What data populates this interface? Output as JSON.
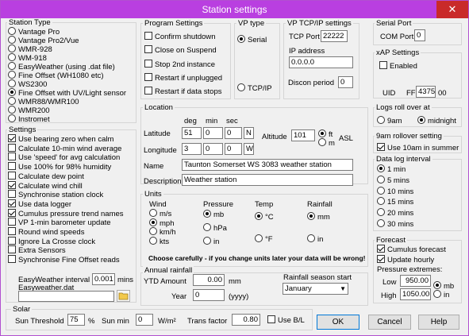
{
  "window": {
    "title": "Station settings",
    "close_glyph": "✕"
  },
  "station_type": {
    "title": "Station Type",
    "options": [
      "Vantage Pro",
      "Vantage Pro2/Vue",
      "WMR-928",
      "WM-918",
      "EasyWeather (using .dat file)",
      "Fine Offset (WH1080 etc)",
      "WS2300",
      "Fine Offset with UV/Light sensor",
      "WMR88/WMR100",
      "WMR200",
      "Instromet"
    ],
    "selected": 7
  },
  "settings": {
    "title": "Settings",
    "items": [
      {
        "label": "Use bearing zero when calm",
        "checked": true
      },
      {
        "label": "Calculate 10-min wind average",
        "checked": false
      },
      {
        "label": "Use 'speed' for avg calculation",
        "checked": false
      },
      {
        "label": "Use 100% for 98% humidity",
        "checked": false
      },
      {
        "label": "Calculate dew point",
        "checked": false
      },
      {
        "label": "Calculate wind chill",
        "checked": true
      },
      {
        "label": "Synchronise station clock",
        "checked": false
      },
      {
        "label": "Use data logger",
        "checked": true
      },
      {
        "label": "Cumulus pressure trend names",
        "checked": true
      },
      {
        "label": "VP 1-min barometer update",
        "checked": false
      },
      {
        "label": "Round wind speeds",
        "checked": false
      },
      {
        "label": "Ignore La Crosse clock",
        "checked": false
      },
      {
        "label": "Extra Sensors",
        "checked": false
      },
      {
        "label": "Synchronise Fine Offset reads",
        "checked": false
      }
    ],
    "easyweather_label": "EasyWeather interval",
    "easyweather_value": "0.001",
    "easyweather_unit": "mins",
    "easyweather_file_label": "Easyweather.dat",
    "easyweather_file_value": ""
  },
  "program": {
    "title": "Program Settings",
    "items": [
      {
        "label": "Confirm shutdown",
        "checked": false
      },
      {
        "label": "Close on Suspend",
        "checked": false
      },
      {
        "label": "Stop 2nd instance",
        "checked": false
      },
      {
        "label": "Restart if unplugged",
        "checked": false
      },
      {
        "label": "Restart if data stops",
        "checked": false
      }
    ]
  },
  "vp_type": {
    "title": "VP type",
    "serial": "Serial",
    "tcpip": "TCP/IP",
    "selected": "serial"
  },
  "vp_tcpip": {
    "title": "VP TCP/IP settings",
    "port_label": "TCP Port",
    "port_value": "22222",
    "ip_label": "IP address",
    "ip_value": "0.0.0.0",
    "discon_label": "Discon period",
    "discon_value": "0"
  },
  "serial_port": {
    "title": "Serial Port",
    "label": "COM Port",
    "value": "0"
  },
  "xap": {
    "title": "xAP Settings",
    "enabled_label": "Enabled",
    "enabled": false,
    "uid_label": "UID",
    "uid_prefix": "FF",
    "uid_value": "4375",
    "uid_suffix": "00"
  },
  "location": {
    "title": "Location",
    "hdr_deg": "deg",
    "hdr_min": "min",
    "hdr_sec": "sec",
    "lat_label": "Latitude",
    "lat_deg": "51",
    "lat_min": "0",
    "lat_sec": "0",
    "lat_hem": "N",
    "lon_label": "Longitude",
    "lon_deg": "3",
    "lon_min": "0",
    "lon_sec": "0",
    "lon_hem": "W",
    "alt_label": "Altitude",
    "alt_value": "101",
    "alt_ft": "ft",
    "alt_m": "m",
    "alt_unit_selected": "ft",
    "asl": "ASL",
    "name_label": "Name",
    "name_value": "Taunton Somerset WS 3083 weather station",
    "desc_label": "Description",
    "desc_value": "Weather station"
  },
  "units": {
    "title": "Units",
    "wind": {
      "title": "Wind",
      "options": [
        "m/s",
        "mph",
        "km/h",
        "kts"
      ],
      "selected": 1
    },
    "pressure": {
      "title": "Pressure",
      "options": [
        "mb",
        "hPa",
        "in"
      ],
      "selected": 0
    },
    "temp": {
      "title": "Temp",
      "options": [
        "°C",
        "°F"
      ],
      "selected": 0
    },
    "rainfall": {
      "title": "Rainfall",
      "options": [
        "mm",
        "in"
      ],
      "selected": 0
    },
    "warning": "Choose carefully - if you change units later your data will be wrong!"
  },
  "annual_rainfall": {
    "title": "Annual rainfall",
    "ytd_label": "YTD Amount",
    "ytd_value": "0.00",
    "ytd_unit": "mm",
    "year_label": "Year",
    "year_value": "0",
    "year_hint": "(yyyy)",
    "season_label": "Rainfall season start",
    "season_value": "January"
  },
  "logs_roll": {
    "title": "Logs roll over at",
    "options": [
      "9am",
      "midnight"
    ],
    "selected": 1
  },
  "rollover_9am": {
    "title": "9am rollover setting",
    "label": "Use 10am in summer",
    "checked": true
  },
  "data_log": {
    "title": "Data log interval",
    "options": [
      "1 min",
      "5 mins",
      "10 mins",
      "15 mins",
      "20 mins",
      "30 mins"
    ],
    "selected": 0
  },
  "forecast": {
    "title": "Forecast",
    "cumulus_label": "Cumulus forecast",
    "cumulus": true,
    "hourly_label": "Update hourly",
    "hourly": true,
    "extremes_label": "Pressure extremes:",
    "low_label": "Low",
    "low_value": "950.00",
    "high_label": "High",
    "high_value": "1050.00",
    "unit_mb": "mb",
    "unit_in": "in",
    "unit_selected": "mb"
  },
  "solar": {
    "title": "Solar",
    "threshold_label": "Sun Threshold",
    "threshold_value": "75",
    "threshold_unit": "%",
    "sunmin_label": "Sun min",
    "sunmin_value": "0",
    "sunmin_unit": "W/m²",
    "trans_label": "Trans factor",
    "trans_value": "0.80",
    "usebl_label": "Use B/L",
    "usebl": false
  },
  "buttons": {
    "ok": "OK",
    "cancel": "Cancel",
    "help": "Help"
  }
}
